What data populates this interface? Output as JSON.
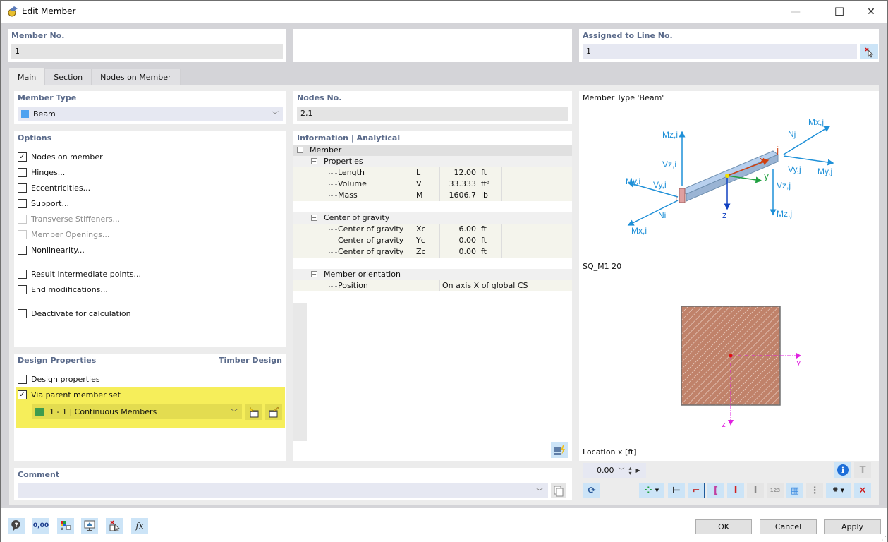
{
  "window": {
    "title": "Edit Member",
    "controls": {
      "minimize": "—",
      "maximize": "☐",
      "close": "✕"
    }
  },
  "header": {
    "member_no_label": "Member No.",
    "member_no_value": "1",
    "assigned_line_label": "Assigned to Line No.",
    "assigned_line_value": "1"
  },
  "tabs": [
    {
      "label": "Main",
      "active": true
    },
    {
      "label": "Section",
      "active": false
    },
    {
      "label": "Nodes on Member",
      "active": false
    }
  ],
  "member_type": {
    "label": "Member Type",
    "value": "Beam",
    "color": "#4ea2f0"
  },
  "options": {
    "label": "Options",
    "items": [
      {
        "label": "Nodes on member",
        "checked": true,
        "disabled": false
      },
      {
        "label": "Hinges...",
        "checked": false,
        "disabled": false
      },
      {
        "label": "Eccentricities...",
        "checked": false,
        "disabled": false
      },
      {
        "label": "Support...",
        "checked": false,
        "disabled": false
      },
      {
        "label": "Transverse Stiffeners...",
        "checked": false,
        "disabled": true
      },
      {
        "label": "Member Openings...",
        "checked": false,
        "disabled": true
      },
      {
        "label": "Nonlinearity...",
        "checked": false,
        "disabled": false
      },
      {
        "label": "Result intermediate points...",
        "checked": false,
        "disabled": false
      },
      {
        "label": "End modifications...",
        "checked": false,
        "disabled": false
      },
      {
        "label": "Deactivate for calculation",
        "checked": false,
        "disabled": false
      }
    ]
  },
  "design_properties": {
    "label": "Design Properties",
    "addon": "Timber Design",
    "design_properties_label": "Design properties",
    "design_properties_checked": false,
    "via_parent_label": "Via parent member set",
    "via_parent_checked": true,
    "parent_set_value": "1 - 1 | Continuous Members",
    "parent_set_color": "#3e9c4e",
    "highlight_color": "#f6ee5a"
  },
  "nodes": {
    "label": "Nodes No.",
    "value": "2,1"
  },
  "info": {
    "label": "Information | Analytical",
    "root": "Member",
    "groups": [
      {
        "name": "Properties",
        "rows": [
          {
            "name": "Length",
            "symbol": "L",
            "value": "12.00",
            "unit": "ft"
          },
          {
            "name": "Volume",
            "symbol": "V",
            "value": "33.333",
            "unit": "ft³"
          },
          {
            "name": "Mass",
            "symbol": "M",
            "value": "1606.7",
            "unit": "lb"
          }
        ]
      },
      {
        "name": "Center of gravity",
        "rows": [
          {
            "name": "Center of gravity",
            "symbol": "Xc",
            "value": "6.00",
            "unit": "ft"
          },
          {
            "name": "Center of gravity",
            "symbol": "Yc",
            "value": "0.00",
            "unit": "ft"
          },
          {
            "name": "Center of gravity",
            "symbol": "Zc",
            "value": "0.00",
            "unit": "ft"
          }
        ]
      },
      {
        "name": "Member orientation",
        "rows": [
          {
            "name": "Position",
            "symbol": "",
            "value": "On axis X of global CS",
            "unit": ""
          }
        ]
      }
    ]
  },
  "preview": {
    "member_type_title": "Member Type 'Beam'",
    "diagram_labels": {
      "mzi": "Mz,i",
      "vzi": "Vz,i",
      "myi": "My,i",
      "vyi": "Vy,i",
      "ni": "Ni",
      "mxi": "Mx,i",
      "mxj": "Mx,j",
      "nj": "Nj",
      "vyj": "Vy,j",
      "myj": "My,j",
      "vzj": "Vz,j",
      "mzj": "Mz,j",
      "i": "i",
      "j": "j",
      "x": "x",
      "y": "y",
      "z": "z"
    },
    "section_name": "SQ_M1 20",
    "section_axis_y": "y",
    "section_axis_z": "z",
    "location_label": "Location x [ft]",
    "location_value": "0.00"
  },
  "comment": {
    "label": "Comment",
    "value": ""
  },
  "buttons": {
    "ok": "OK",
    "cancel": "Cancel",
    "apply": "Apply"
  }
}
